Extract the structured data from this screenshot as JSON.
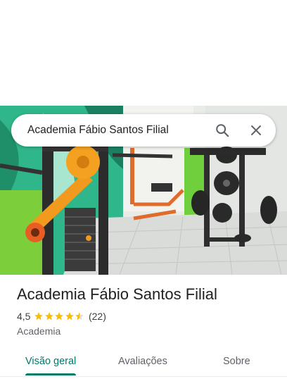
{
  "search": {
    "query": "Academia Fábio Santos Filial",
    "search_icon": "search-icon",
    "close_icon": "close-icon"
  },
  "hero": {
    "photo": "gym-interior-photo"
  },
  "place": {
    "name": "Academia Fábio Santos Filial",
    "rating": "4,5",
    "stars": 4.5,
    "review_count": "(22)",
    "category": "Academia"
  },
  "tabs": [
    {
      "label": "Visão geral",
      "active": true
    },
    {
      "label": "Avaliações",
      "active": false
    },
    {
      "label": "Sobre",
      "active": false
    }
  ],
  "colors": {
    "accent": "#00796b",
    "star": "#fbbc04",
    "star_empty": "#dadce0"
  }
}
